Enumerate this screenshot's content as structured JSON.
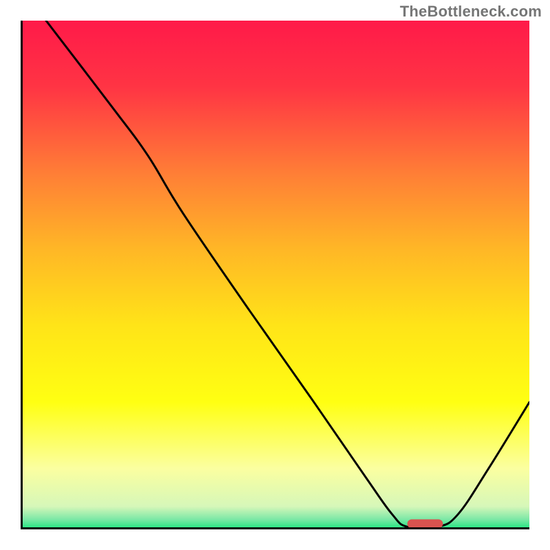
{
  "watermark": "TheBottleneck.com",
  "chart_data": {
    "type": "line",
    "title": "",
    "xlabel": "",
    "ylabel": "",
    "xlim": [
      0,
      100
    ],
    "ylim": [
      0,
      100
    ],
    "grid": false,
    "legend": false,
    "background_gradient": {
      "direction": "vertical",
      "stops": [
        {
          "pos": 0.0,
          "color": "#ff1a49"
        },
        {
          "pos": 0.13,
          "color": "#ff3444"
        },
        {
          "pos": 0.3,
          "color": "#ff7e36"
        },
        {
          "pos": 0.45,
          "color": "#ffb726"
        },
        {
          "pos": 0.6,
          "color": "#ffe418"
        },
        {
          "pos": 0.75,
          "color": "#ffff12"
        },
        {
          "pos": 0.88,
          "color": "#fbffa0"
        },
        {
          "pos": 0.955,
          "color": "#d6f7b9"
        },
        {
          "pos": 0.98,
          "color": "#7de8a6"
        },
        {
          "pos": 1.0,
          "color": "#19e57e"
        }
      ]
    },
    "curve": [
      {
        "x": 5.0,
        "y": 100.0
      },
      {
        "x": 18.0,
        "y": 83.0
      },
      {
        "x": 25.0,
        "y": 73.5
      },
      {
        "x": 32.0,
        "y": 62.0
      },
      {
        "x": 45.0,
        "y": 43.0
      },
      {
        "x": 58.0,
        "y": 24.5
      },
      {
        "x": 68.0,
        "y": 10.0
      },
      {
        "x": 73.0,
        "y": 3.0
      },
      {
        "x": 76.0,
        "y": 0.5
      },
      {
        "x": 82.0,
        "y": 0.5
      },
      {
        "x": 86.0,
        "y": 3.0
      },
      {
        "x": 92.0,
        "y": 12.0
      },
      {
        "x": 100.0,
        "y": 25.0
      }
    ],
    "marker": {
      "x_start": 76.0,
      "x_end": 83.0,
      "y": 1.1,
      "color": "#d9534f"
    },
    "axes_color": "#000000",
    "curve_color": "#000000",
    "curve_width": 3
  }
}
